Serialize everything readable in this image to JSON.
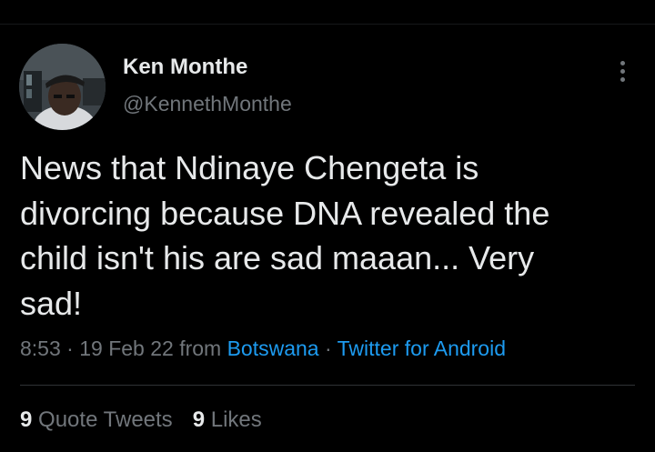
{
  "author": {
    "display_name": "Ken Monthe",
    "handle": "@KennethMonthe",
    "avatar_icon": "profile-photo"
  },
  "more_icon": "more-vertical-icon",
  "tweet": {
    "lines": [
      "News that Ndinaye Chengeta is",
      "divorcing because DNA revealed the",
      "child isn't his are sad maaan... Very",
      "sad!"
    ]
  },
  "meta": {
    "time": "8:53",
    "separator": " · ",
    "date": "19 Feb 22",
    "from_label": " from ",
    "location": "Botswana",
    "source": "Twitter for Android"
  },
  "stats": {
    "quote_count": "9",
    "quote_label": "Quote Tweets",
    "like_count": "9",
    "like_label": "Likes"
  },
  "colors": {
    "background": "#000000",
    "text": "#e7e9ea",
    "secondary": "#71767b",
    "link": "#1d9bf0",
    "divider": "#2f3336"
  }
}
